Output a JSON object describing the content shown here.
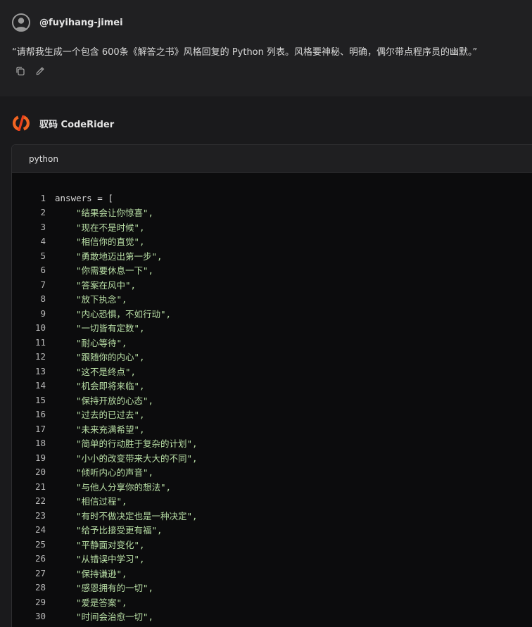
{
  "user": {
    "name": "@fuyihang-jimei",
    "prompt": "“请帮我生成一个包含 600条《解答之书》风格回复的 Python 列表。风格要神秘、明确，偶尔带点程序员的幽默。”",
    "actions": [
      {
        "name": "copy-icon"
      },
      {
        "name": "edit-icon"
      }
    ]
  },
  "assistant": {
    "name": "驭码 CodeRider",
    "logo_colors": {
      "primary": "#f26522",
      "accent": "#e8401c"
    }
  },
  "code_block": {
    "language": "python",
    "lines": [
      {
        "no": "1",
        "text": "answers = ["
      },
      {
        "no": "2",
        "text": "\"结果会让你惊喜\","
      },
      {
        "no": "3",
        "text": "\"现在不是时候\","
      },
      {
        "no": "4",
        "text": "\"相信你的直觉\","
      },
      {
        "no": "5",
        "text": "\"勇敢地迈出第一步\","
      },
      {
        "no": "6",
        "text": "\"你需要休息一下\","
      },
      {
        "no": "7",
        "text": "\"答案在风中\","
      },
      {
        "no": "8",
        "text": "\"放下执念\","
      },
      {
        "no": "9",
        "text": "\"内心恐惧，不如行动\","
      },
      {
        "no": "10",
        "text": "\"一切皆有定数\","
      },
      {
        "no": "11",
        "text": "\"耐心等待\","
      },
      {
        "no": "12",
        "text": "\"跟随你的内心\","
      },
      {
        "no": "13",
        "text": "\"这不是终点\","
      },
      {
        "no": "14",
        "text": "\"机会即将来临\","
      },
      {
        "no": "15",
        "text": "\"保持开放的心态\","
      },
      {
        "no": "16",
        "text": "\"过去的已过去\","
      },
      {
        "no": "17",
        "text": "\"未来充满希望\","
      },
      {
        "no": "18",
        "text": "\"简单的行动胜于复杂的计划\","
      },
      {
        "no": "19",
        "text": "\"小小的改变带来大大的不同\","
      },
      {
        "no": "20",
        "text": "\"倾听内心的声音\","
      },
      {
        "no": "21",
        "text": "\"与他人分享你的想法\","
      },
      {
        "no": "22",
        "text": "\"相信过程\","
      },
      {
        "no": "23",
        "text": "\"有时不做决定也是一种决定\","
      },
      {
        "no": "24",
        "text": "\"给予比接受更有福\","
      },
      {
        "no": "25",
        "text": "\"平静面对变化\","
      },
      {
        "no": "26",
        "text": "\"从错误中学习\","
      },
      {
        "no": "27",
        "text": "\"保持谦逊\","
      },
      {
        "no": "28",
        "text": "\"感恩拥有的一切\","
      },
      {
        "no": "29",
        "text": "\"爱是答案\","
      },
      {
        "no": "30",
        "text": "\"时间会治愈一切\","
      }
    ]
  }
}
